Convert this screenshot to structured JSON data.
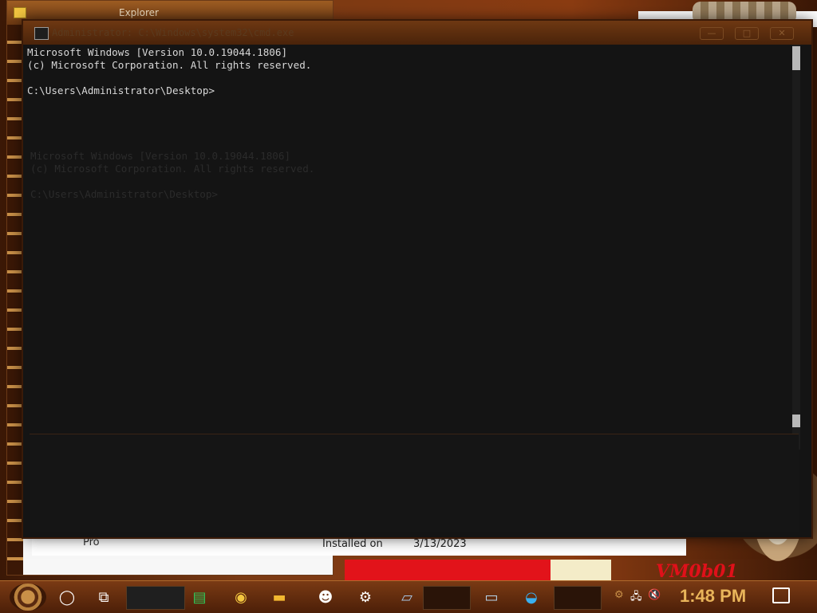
{
  "desktop": {
    "vm_label": "VM0b01"
  },
  "explorer": {
    "title": "Explorer",
    "row_label": "Pro",
    "installed_label": "Installed on",
    "installed_date": "3/13/2023"
  },
  "cmd": {
    "title": "Administrator: C:\\Windows\\system32\\cmd.exe",
    "lines": [
      "Microsoft Windows [Version 10.0.19044.1806]",
      "(c) Microsoft Corporation. All rights reserved.",
      "",
      "C:\\Users\\Administrator\\Desktop>"
    ],
    "ghost_lines": [
      "Microsoft Windows [Version 10.0.19044.1806]",
      "(c) Microsoft Corporation. All rights reserved.",
      "",
      "C:\\Users\\Administrator\\Desktop>"
    ],
    "minimize": "—",
    "maximize": "□",
    "close": "✕"
  },
  "taskbar": {
    "time": "1:48 PM",
    "icons": [
      "start-gear-icon",
      "cortana-circle-icon",
      "task-view-icon",
      "sheets-icon",
      "chrome-icon",
      "file-explorer-icon",
      "people-icon",
      "settings-gear-icon",
      "notepad-icon",
      "calculator-icon",
      "remote-desktop-icon",
      "edge-icon"
    ]
  }
}
